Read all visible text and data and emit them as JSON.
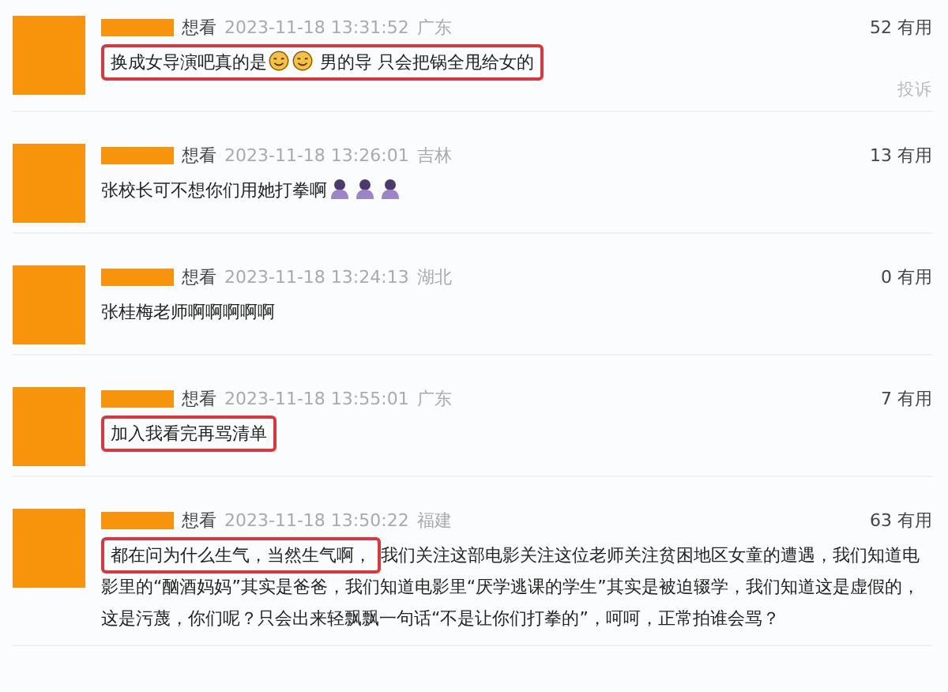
{
  "comments": [
    {
      "status": "想看",
      "time": "2023-11-18 13:31:52",
      "location": "广东",
      "votes": "52 有用",
      "report": "投诉",
      "highlighted": true,
      "segments": [
        {
          "kind": "text",
          "text": "换成女导演吧真的是"
        },
        {
          "kind": "smiley"
        },
        {
          "kind": "smiley"
        },
        {
          "kind": "text",
          "text": " 男的导 只会把锅全甩给女的"
        }
      ]
    },
    {
      "status": "想看",
      "time": "2023-11-18 13:26:01",
      "location": "吉林",
      "votes": "13 有用",
      "highlighted": false,
      "segments": [
        {
          "kind": "text",
          "text": "张校长可不想你们用她打拳啊"
        },
        {
          "kind": "figure"
        },
        {
          "kind": "figure"
        },
        {
          "kind": "figure"
        }
      ]
    },
    {
      "status": "想看",
      "time": "2023-11-18 13:24:13",
      "location": "湖北",
      "votes": "0 有用",
      "highlighted": false,
      "segments": [
        {
          "kind": "text",
          "text": "张桂梅老师啊啊啊啊啊"
        }
      ]
    },
    {
      "status": "想看",
      "time": "2023-11-18 13:55:01",
      "location": "广东",
      "votes": "7 有用",
      "highlighted": true,
      "segments": [
        {
          "kind": "text",
          "text": "加入我看完再骂清单"
        }
      ]
    },
    {
      "status": "想看",
      "time": "2023-11-18 13:50:22",
      "location": "福建",
      "votes": "63 有用",
      "lead": "都在问为什么生气，当然生气啊，",
      "highlighted": true,
      "segments": [
        {
          "kind": "text",
          "text": "我们关注这部电影关注这位老师关注贫困地区女童的遭遇，我们知道电影里的“酗酒妈妈”其实是爸爸，我们知道电影里“厌学逃课的学生”其实是被迫辍学，我们知道这是虚假的，这是污蔑，你们呢？只会出来轻飘飘一句话“不是让你们打拳的”，呵呵，正常拍谁会骂？"
        }
      ]
    }
  ]
}
